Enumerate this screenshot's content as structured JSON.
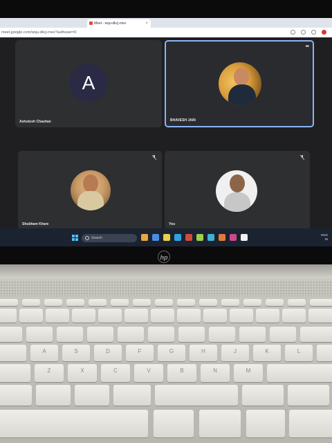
{
  "browser": {
    "tab_title": "Meet - wqu-dkcj-mev",
    "url": "meet.google.com/wqu-dkcj-mev?authuser=0"
  },
  "meeting": {
    "code": "wqu-dkcj-mev",
    "participants": [
      {
        "name": "Ashutosh Chauhan",
        "initial": "A",
        "active": false
      },
      {
        "name": "BHAVESH JAIN",
        "active": true
      },
      {
        "name": "Shubham Khare",
        "active": false
      },
      {
        "name": "You",
        "active": false
      }
    ]
  },
  "taskbar": {
    "search_label": "Search",
    "tray_lang": "ENG",
    "tray_region": "IN"
  },
  "laptop": {
    "brand": "hp"
  },
  "keyboard": {
    "row3": [
      "A",
      "S",
      "D",
      "F",
      "G",
      "H",
      "J",
      "K",
      "L"
    ],
    "row4": [
      "Z",
      "X",
      "C",
      "V",
      "B",
      "N",
      "M"
    ]
  }
}
